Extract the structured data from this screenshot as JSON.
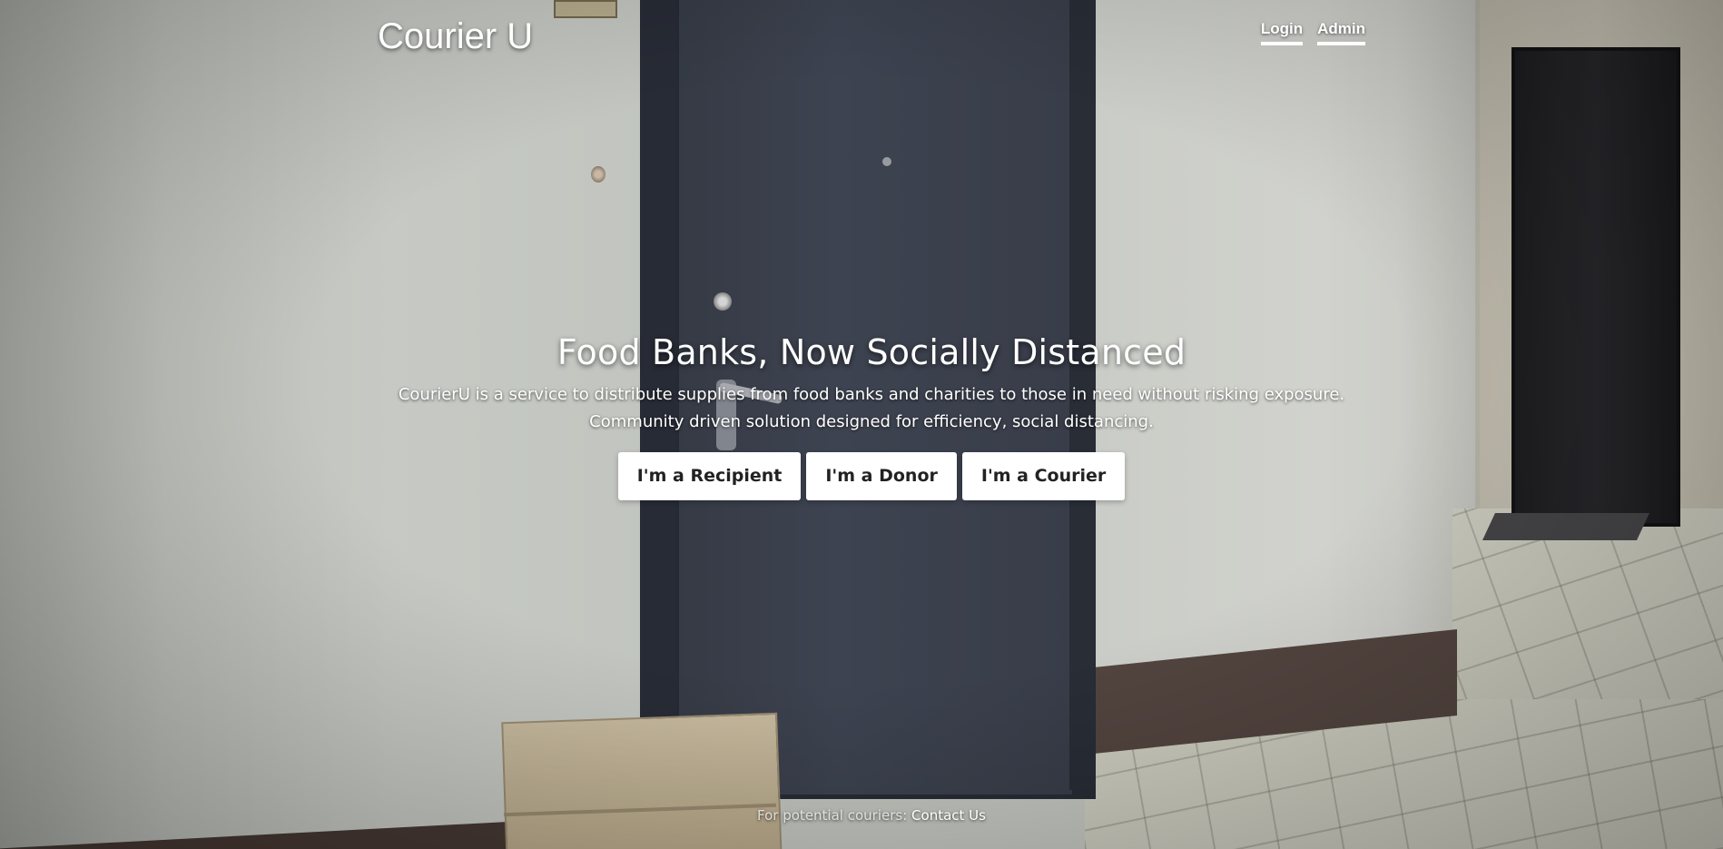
{
  "header": {
    "brand": "Courier U",
    "nav": [
      {
        "label": "Login"
      },
      {
        "label": "Admin"
      }
    ]
  },
  "hero": {
    "title": "Food Banks, Now Socially Distanced",
    "description_line1": "CourierU is a service to distribute supplies from food banks and charities to those in need without risking exposure.",
    "description_line2": "Community driven solution designed for efficiency, social distancing.",
    "buttons": [
      {
        "label": "I'm a Recipient"
      },
      {
        "label": "I'm a Donor"
      },
      {
        "label": "I'm a Courier"
      }
    ]
  },
  "footer": {
    "label": "For potential couriers:",
    "link": "Contact Us"
  },
  "colors": {
    "text": "#ffffff",
    "button_bg": "#ffffff",
    "button_text": "#222222",
    "door": "#3e4451"
  }
}
